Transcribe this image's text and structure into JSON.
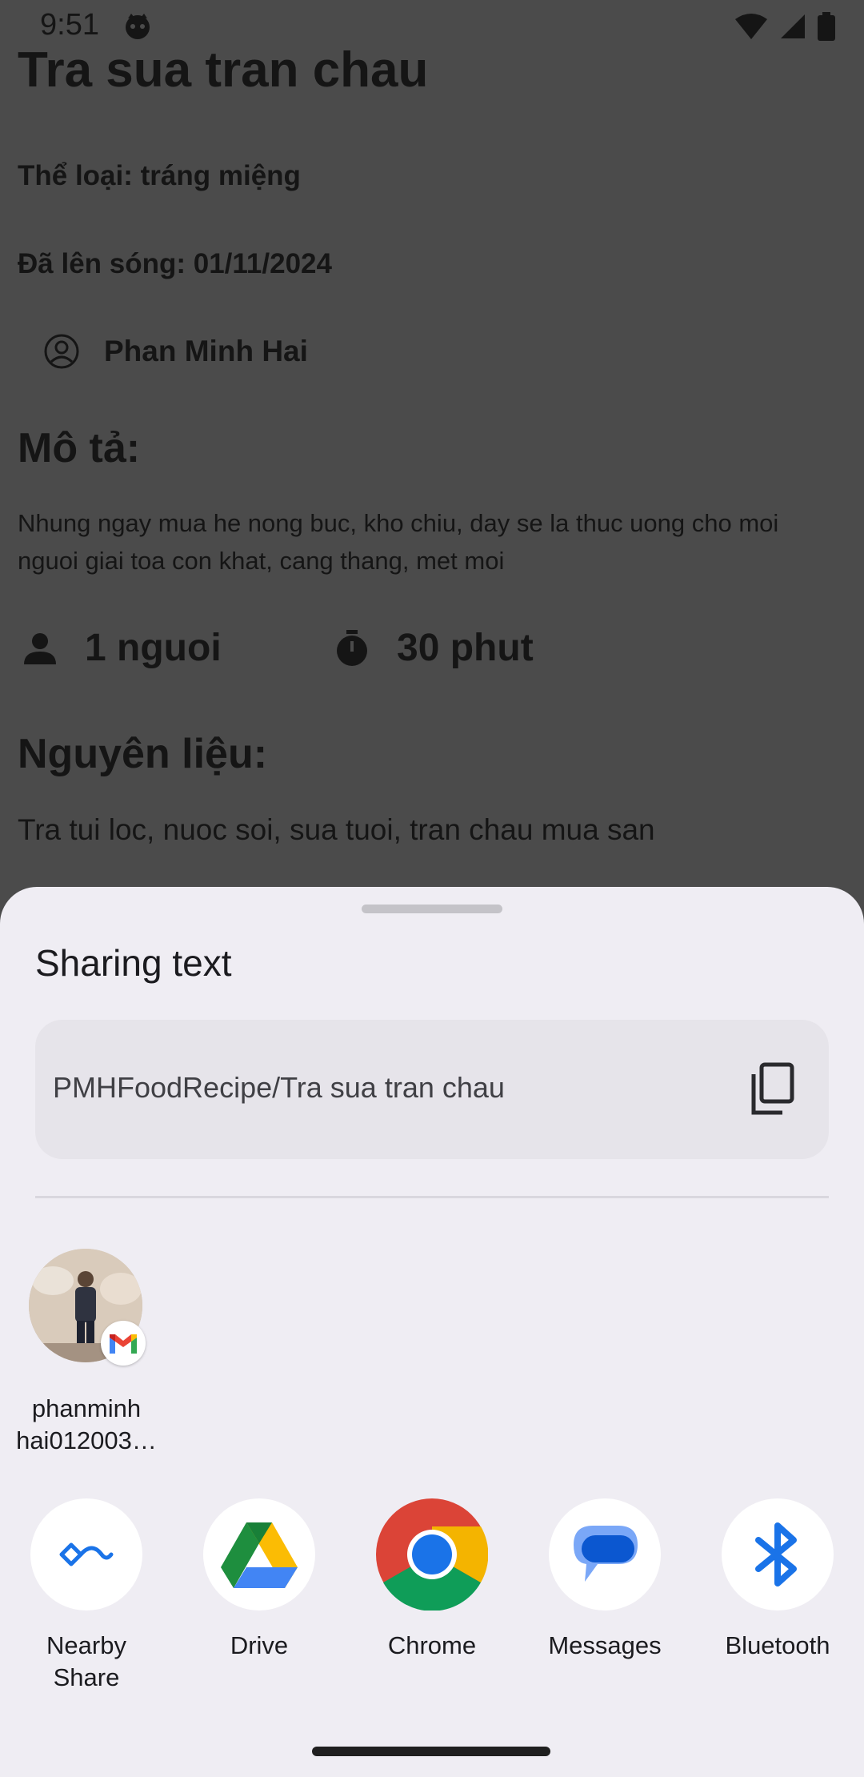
{
  "status_bar": {
    "time": "9:51"
  },
  "recipe": {
    "title": "Tra sua tran chau",
    "category": "Thể loại: tráng miệng",
    "published": "Đã lên sóng: 01/11/2024",
    "author": "Phan Minh Hai",
    "description_heading": "Mô tả:",
    "description": "Nhung ngay mua he nong buc, kho chiu, day se la thuc uong cho moi nguoi giai toa con khat, cang thang, met moi",
    "servings": "1 nguoi",
    "time": "30 phut",
    "ingredients_heading": "Nguyên liệu:",
    "ingredients": "Tra tui loc, nuoc soi, sua tuoi, tran chau mua san"
  },
  "share_sheet": {
    "title": "Sharing text",
    "shared_text": "PMHFoodRecipe/Tra sua tran chau",
    "contacts": [
      {
        "name_line1": "phanminh",
        "name_line2": "hai012003…"
      }
    ],
    "apps": [
      {
        "line1": "Nearby",
        "line2": "Share"
      },
      {
        "line1": "Drive",
        "line2": ""
      },
      {
        "line1": "Chrome",
        "line2": ""
      },
      {
        "line1": "Messages",
        "line2": ""
      },
      {
        "line1": "Bluetooth",
        "line2": ""
      }
    ]
  }
}
